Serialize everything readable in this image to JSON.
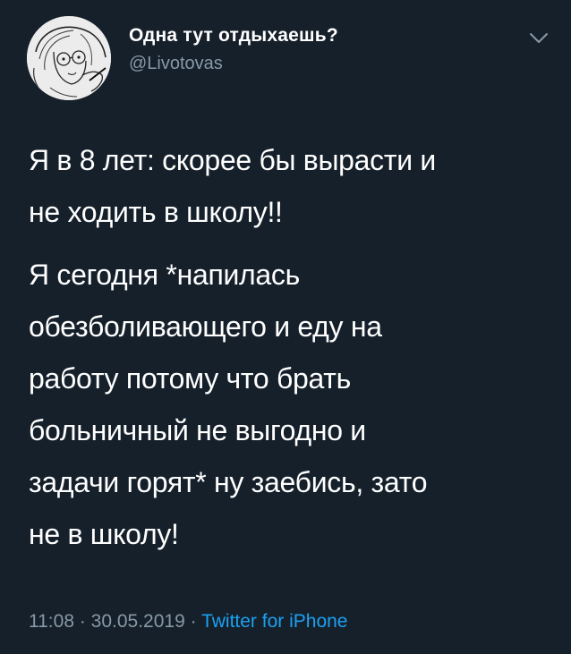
{
  "colors": {
    "background": "#15202b",
    "primary_text": "#ffffff",
    "secondary_text": "#8899a6",
    "link": "#1da1f2"
  },
  "author": {
    "display_name": "Одна тут отдыхаешь?",
    "handle": "@Livotovas",
    "avatar_icon": "avatar-sketch-portrait"
  },
  "menu_icon": "chevron-down-icon",
  "tweet": {
    "line1": "Я в 8 лет: скорее бы вырасти и",
    "line2": "не ходить в школу!!",
    "line3": "Я сегодня *напилась",
    "line4": "обезболивающего и еду на",
    "line5": "работу потому что брать",
    "line6": "больничный не выгодно и",
    "line7": "задачи горят* ну заебись, зато",
    "line8": "не в школу!"
  },
  "meta": {
    "time": "11:08",
    "separator1": " · ",
    "date": "30.05.2019",
    "separator2": " · ",
    "source": "Twitter for iPhone"
  }
}
